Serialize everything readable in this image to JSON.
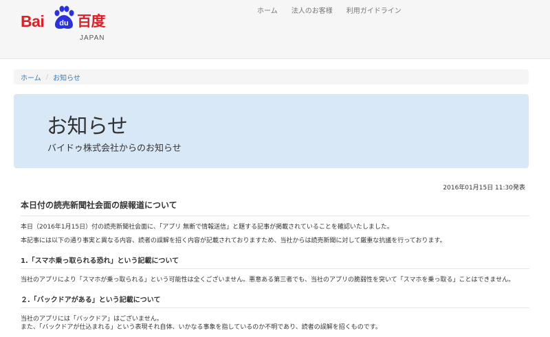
{
  "brand": {
    "name_latin": "Bai",
    "paw_text": "du",
    "name_cjk": "百度",
    "region": "JAPAN",
    "colors": {
      "red": "#de1f26",
      "blue": "#2932e1"
    }
  },
  "nav": {
    "items": [
      {
        "label": "ホーム"
      },
      {
        "label": "法人のお客様"
      },
      {
        "label": "利用ガイドライン"
      }
    ]
  },
  "breadcrumb": {
    "home": "ホーム",
    "separator": "/",
    "current": "お知らせ"
  },
  "hero": {
    "title": "お知らせ",
    "subtitle": "バイドゥ株式会社からのお知らせ"
  },
  "article": {
    "date": "2016年01月15日 11:30発表",
    "title": "本日付の読売新聞社会面の誤報道について",
    "intro_1": "本日（2016年1月15日）付の読売新聞社会面に、「アプリ 無断で情報送信」と題する記事が掲載されていることを確認いたしました。",
    "intro_2": "本記事には以下の通り事実と異なる内容、読者の誤解を招く内容が記載されておりますため、当社からは読売新聞に対して厳重な抗議を行っております。",
    "section_1_title": "1.「スマホ乗っ取られる恐れ」という記載について",
    "section_1_body": "当社のアプリにより「スマホが乗っ取られる」という可能性は全くございません。悪意ある第三者でも、当社のアプリの脆弱性を突いて「スマホを乗っ取る」ことはできません。",
    "section_2_title": "２.「バックドアがある」という記載について",
    "section_2_body_1": "当社のアプリには「バックドア」はございません。",
    "section_2_body_2": "また、「バックドアが仕込まれる」という表現それ自体、いかなる事象を指しているのか不明であり、読者の誤解を招くものです。"
  }
}
